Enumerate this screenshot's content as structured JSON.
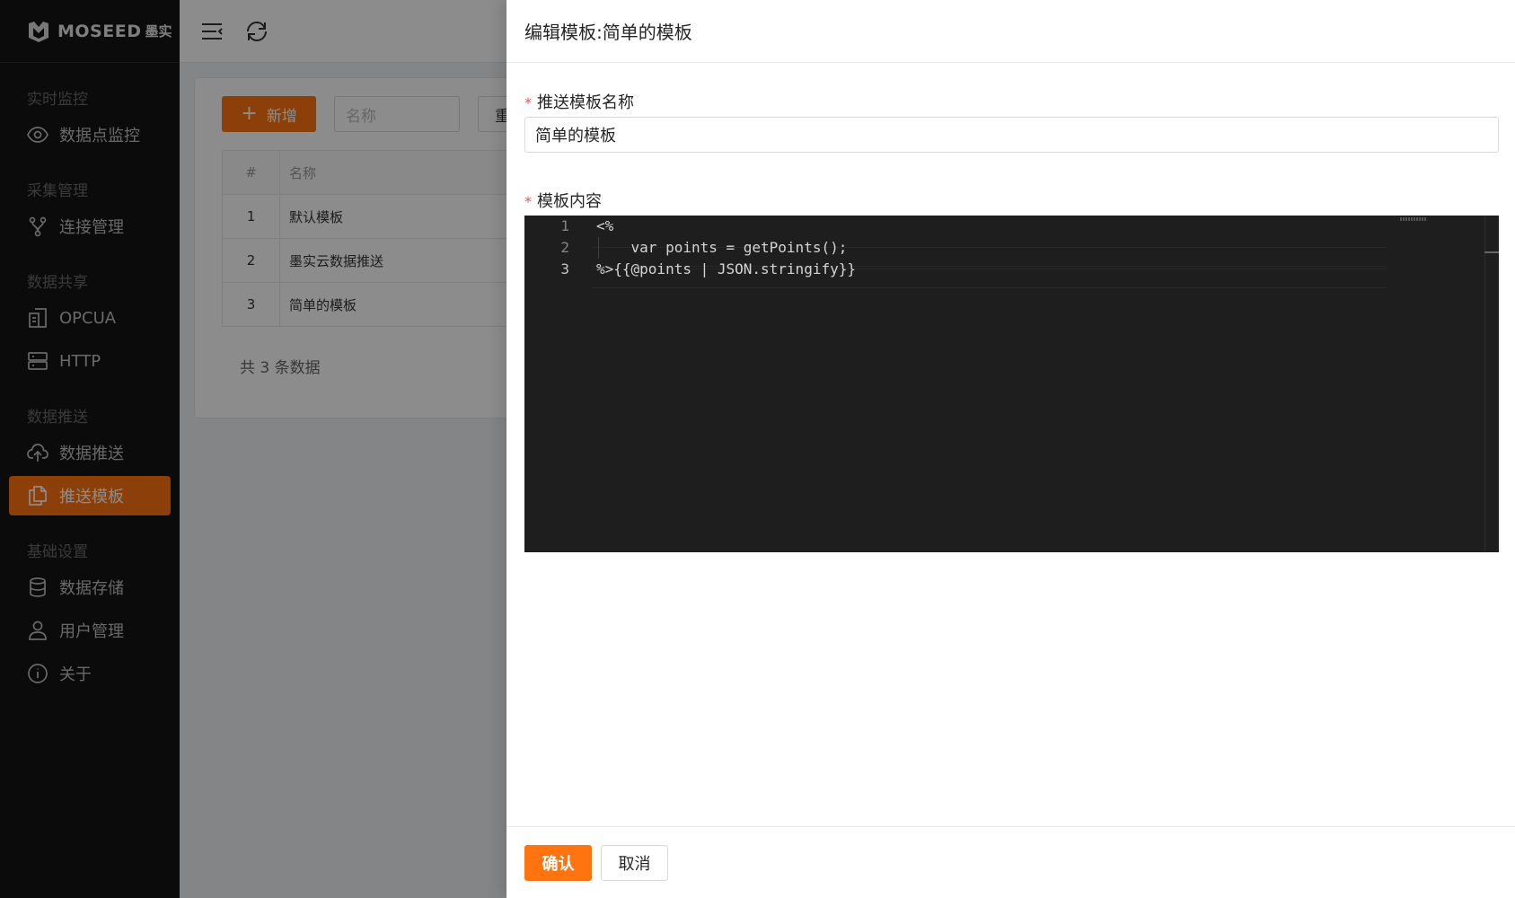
{
  "sidebar": {
    "logo_text": "MOSEED",
    "logo_cn": "墨实",
    "groups": [
      {
        "title": "实时监控",
        "items": [
          {
            "label": "数据点监控",
            "icon": "eye-icon"
          }
        ]
      },
      {
        "title": "采集管理",
        "items": [
          {
            "label": "连接管理",
            "icon": "branch-icon"
          }
        ]
      },
      {
        "title": "数据共享",
        "items": [
          {
            "label": "OPCUA",
            "icon": "building-icon"
          },
          {
            "label": "HTTP",
            "icon": "server-icon"
          }
        ]
      },
      {
        "title": "数据推送",
        "items": [
          {
            "label": "数据推送",
            "icon": "cloud-upload-icon"
          },
          {
            "label": "推送模板",
            "icon": "copy-icon",
            "active": true
          }
        ]
      },
      {
        "title": "基础设置",
        "items": [
          {
            "label": "数据存储",
            "icon": "database-icon"
          },
          {
            "label": "用户管理",
            "icon": "user-icon"
          },
          {
            "label": "关于",
            "icon": "info-icon"
          }
        ]
      }
    ]
  },
  "header": {
    "menu_icon": "menu-fold-icon",
    "refresh_icon": "refresh-icon"
  },
  "main": {
    "add_button": "新增",
    "search_placeholder": "名称",
    "reset_button": "重",
    "table": {
      "columns": [
        "#",
        "名称"
      ],
      "rows": [
        {
          "idx": "1",
          "name": "默认模板"
        },
        {
          "idx": "2",
          "name": "墨实云数据推送"
        },
        {
          "idx": "3",
          "name": "简单的模板"
        }
      ]
    },
    "total_text": "共 3 条数据"
  },
  "drawer": {
    "title": "编辑模板:简单的模板",
    "name_label": "推送模板名称",
    "name_value": "简单的模板",
    "content_label": "模板内容",
    "code_lines": [
      {
        "no": "1",
        "text": "<%"
      },
      {
        "no": "2",
        "text": "    var points = getPoints();"
      },
      {
        "no": "3",
        "text": "%>{{@points | JSON.stringify}}"
      }
    ],
    "confirm_button": "确认",
    "cancel_button": "取消"
  },
  "colors": {
    "accent": "#ff7410",
    "sidebar_bg": "#141414",
    "editor_bg": "#1e1e1e",
    "required": "#ff4d4f"
  }
}
